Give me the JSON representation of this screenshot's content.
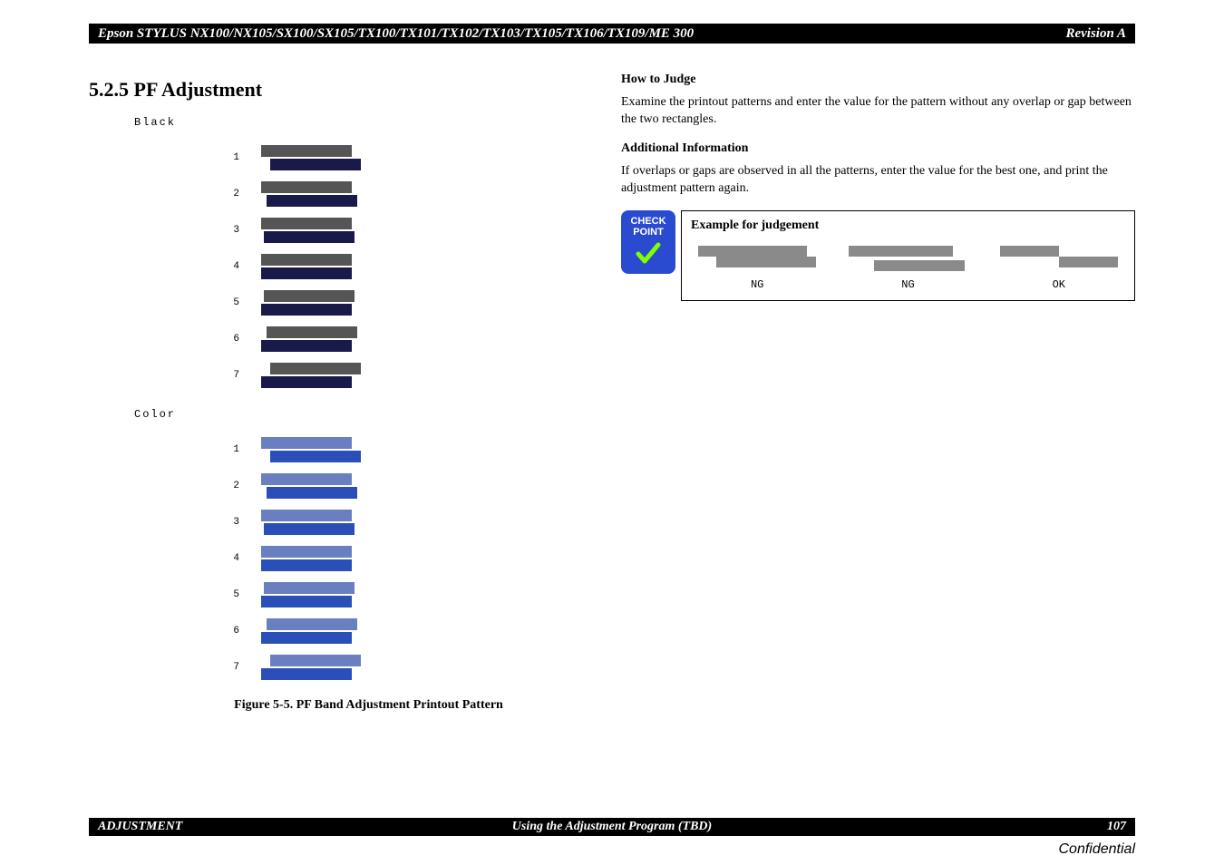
{
  "header": {
    "title": "Epson STYLUS NX100/NX105/SX100/SX105/TX100/TX101/TX102/TX103/TX105/TX106/TX109/ME 300",
    "revision": "Revision A"
  },
  "left": {
    "section_number_and_title": "5.2.5  PF Adjustment",
    "groups": [
      {
        "label": "Black",
        "css": "black",
        "rows": [
          "1",
          "2",
          "3",
          "4",
          "5",
          "6",
          "7"
        ]
      },
      {
        "label": "Color",
        "css": "color",
        "rows": [
          "1",
          "2",
          "3",
          "4",
          "5",
          "6",
          "7"
        ]
      }
    ],
    "figure_caption": "Figure 5-5.  PF Band Adjustment Printout Pattern"
  },
  "right": {
    "h1": "How to Judge",
    "p1": "Examine the printout patterns and enter the value for the pattern without any overlap or gap between the two rectangles.",
    "h2": "Additional Information",
    "p2": "If overlaps or gaps are observed in all the patterns, enter the value for the best one, and print the adjustment pattern again.",
    "checkpoint": {
      "badge_line1": "CHECK",
      "badge_line2": "POINT",
      "box_title": "Example for judgement",
      "labels": [
        "NG",
        "NG",
        "OK"
      ]
    }
  },
  "footer": {
    "left": "ADJUSTMENT",
    "center": "Using the Adjustment Program (TBD)",
    "right": "107",
    "confidential": "Confidential"
  }
}
